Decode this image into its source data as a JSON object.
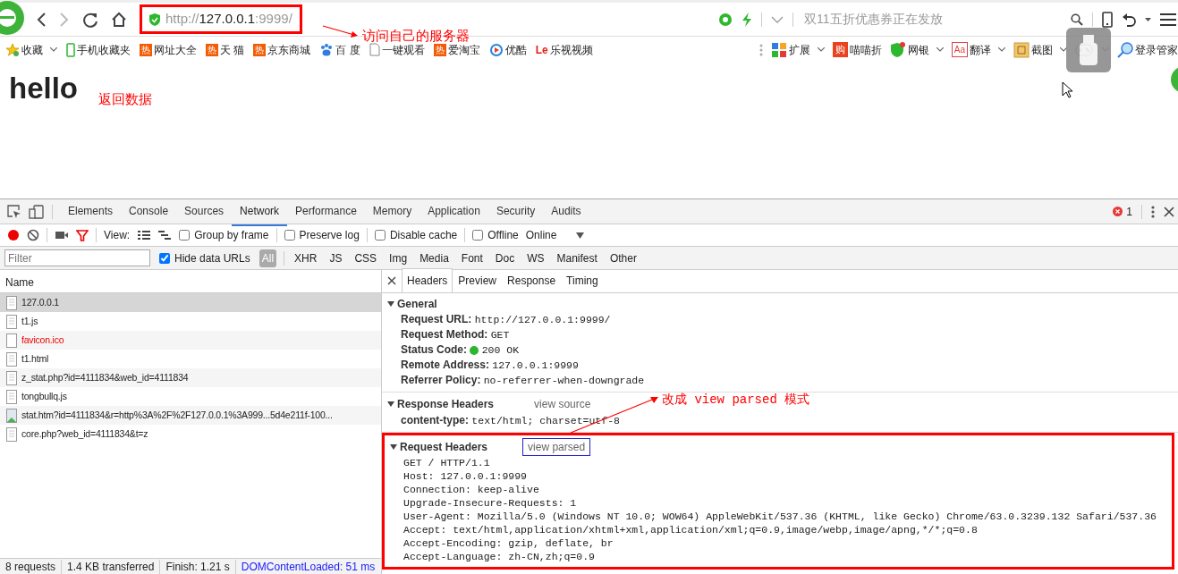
{
  "browser": {
    "forward_disabled": true,
    "address": {
      "scheme": "http://",
      "host": "127.0.0.1",
      "port": ":9999/",
      "highlighted": true
    },
    "search": {
      "placeholder": "双11五折优惠券正在发放"
    }
  },
  "bookmarks": [
    {
      "kind": "star",
      "label": "收藏",
      "dropdown": true
    },
    {
      "kind": "phone",
      "label": "手机收藏夹",
      "dropdown": false
    },
    {
      "kind": "hot",
      "icon_text": "热",
      "label": "网址大全",
      "dropdown": false
    },
    {
      "kind": "hot",
      "icon_text": "热",
      "label": "天 猫",
      "dropdown": false
    },
    {
      "kind": "hot",
      "icon_text": "热",
      "label": "京东商城",
      "dropdown": false
    },
    {
      "kind": "paw",
      "label": "百 度",
      "dropdown": false
    },
    {
      "kind": "page",
      "label": "一键观看",
      "dropdown": false
    },
    {
      "kind": "hot",
      "icon_text": "热",
      "label": "爱淘宝",
      "dropdown": false
    },
    {
      "kind": "play",
      "label": "优酷",
      "dropdown": false
    },
    {
      "kind": "le",
      "icon_text": "Le",
      "label": "乐视视频",
      "dropdown": false
    }
  ],
  "toolbar_items": [
    {
      "kind": "grid",
      "label": "扩展",
      "dropdown": true
    },
    {
      "kind": "gou",
      "icon_text": "购",
      "label": "喵喵折",
      "dropdown": false
    },
    {
      "kind": "shield",
      "label": "网银",
      "dropdown": true
    },
    {
      "kind": "aa",
      "icon_text": "Aa",
      "label": "翻译",
      "dropdown": true
    },
    {
      "kind": "crop",
      "label": "截图",
      "dropdown": true
    },
    {
      "kind": "gamepad",
      "dropdown": true
    },
    {
      "kind": "key",
      "label": "登录管家",
      "dropdown": false
    }
  ],
  "page": {
    "heading": "hello"
  },
  "annotations": [
    {
      "text": "访问自己的服务器"
    },
    {
      "text": "返回数据"
    },
    {
      "text": "改成 view parsed 模式"
    }
  ],
  "devtools": {
    "tabs": [
      {
        "label": "Elements",
        "selected": false
      },
      {
        "label": "Console",
        "selected": false
      },
      {
        "label": "Sources",
        "selected": false
      },
      {
        "label": "Network",
        "selected": true
      },
      {
        "label": "Performance",
        "selected": false
      },
      {
        "label": "Memory",
        "selected": false
      },
      {
        "label": "Application",
        "selected": false
      },
      {
        "label": "Security",
        "selected": false
      },
      {
        "label": "Audits",
        "selected": false
      }
    ],
    "error_count": "1",
    "recording": true,
    "filter_active": true,
    "view_label": "View:",
    "options": [
      {
        "label": "Group by frame",
        "checked": false
      },
      {
        "label": "Preserve log",
        "checked": false
      },
      {
        "label": "Disable cache",
        "checked": false
      },
      {
        "label": "Offline",
        "checked": false
      }
    ],
    "throttling": "Online",
    "filter": {
      "placeholder": "Filter"
    },
    "hide_data_urls": {
      "label": "Hide data URLs",
      "checked": true
    },
    "types": [
      {
        "label": "All",
        "selected": true
      },
      {
        "label": "XHR",
        "selected": false
      },
      {
        "label": "JS",
        "selected": false
      },
      {
        "label": "CSS",
        "selected": false
      },
      {
        "label": "Img",
        "selected": false
      },
      {
        "label": "Media",
        "selected": false
      },
      {
        "label": "Font",
        "selected": false
      },
      {
        "label": "Doc",
        "selected": false
      },
      {
        "label": "WS",
        "selected": false
      },
      {
        "label": "Manifest",
        "selected": false
      },
      {
        "label": "Other",
        "selected": false
      }
    ],
    "list_header": "Name",
    "requests": [
      {
        "name": "127.0.0.1",
        "kind": "doc",
        "selected": true,
        "error": false
      },
      {
        "name": "t1.js",
        "kind": "doc",
        "selected": false,
        "error": false
      },
      {
        "name": "favicon.ico",
        "kind": "blank",
        "selected": false,
        "error": true
      },
      {
        "name": "t1.html",
        "kind": "doc",
        "selected": false,
        "error": false
      },
      {
        "name": "z_stat.php?id=4111834&web_id=4111834",
        "kind": "doc",
        "selected": false,
        "error": false
      },
      {
        "name": "tongbullq.js",
        "kind": "doc",
        "selected": false,
        "error": false
      },
      {
        "name": "stat.htm?id=4111834&r=http%3A%2F%2F127.0.0.1%3A999...5d4e211f-100...",
        "kind": "image",
        "selected": false,
        "error": false
      },
      {
        "name": "core.php?web_id=4111834&t=z",
        "kind": "doc",
        "selected": false,
        "error": false
      }
    ],
    "detail_tabs": [
      {
        "label": "Headers",
        "selected": true
      },
      {
        "label": "Preview",
        "selected": false
      },
      {
        "label": "Response",
        "selected": false
      },
      {
        "label": "Timing",
        "selected": false
      }
    ],
    "sections": [
      {
        "title": "General",
        "expanded": true,
        "rows": [
          {
            "key": "Request URL:",
            "value": "http://127.0.0.1:9999/"
          },
          {
            "key": "Request Method:",
            "value": "GET"
          },
          {
            "key": "Status Code:",
            "value": "200 OK",
            "color": "#2db52d"
          },
          {
            "key": "Remote Address:",
            "value": "127.0.0.1:9999"
          },
          {
            "key": "Referrer Policy:",
            "value": "no-referrer-when-downgrade"
          }
        ]
      },
      {
        "title": "Response Headers",
        "expanded": true,
        "link": "view source",
        "highlighted": false,
        "rows": [
          {
            "key": "content-type:",
            "value": "text/html; charset=utf-8"
          }
        ]
      },
      {
        "title": "Request Headers",
        "expanded": true,
        "link": "view parsed",
        "highlighted": true,
        "lines": [
          "GET / HTTP/1.1",
          "Host: 127.0.0.1:9999",
          "Connection: keep-alive",
          "Upgrade-Insecure-Requests: 1",
          "User-Agent: Mozilla/5.0 (Windows NT 10.0; WOW64) AppleWebKit/537.36 (KHTML, like Gecko) Chrome/63.0.3239.132 Safari/537.36",
          "Accept: text/html,application/xhtml+xml,application/xml;q=0.9,image/webp,image/apng,*/*;q=0.8",
          "Accept-Encoding: gzip, deflate, br",
          "Accept-Language: zh-CN,zh;q=0.9"
        ]
      }
    ],
    "summary": [
      {
        "text": "8 requests",
        "kind": "plain"
      },
      {
        "text": "1.4 KB transferred",
        "kind": "plain"
      },
      {
        "text": "Finish: 1.21 s",
        "kind": "plain"
      },
      {
        "text": "DOMContentLoaded: 51 ms",
        "kind": "link"
      }
    ]
  }
}
